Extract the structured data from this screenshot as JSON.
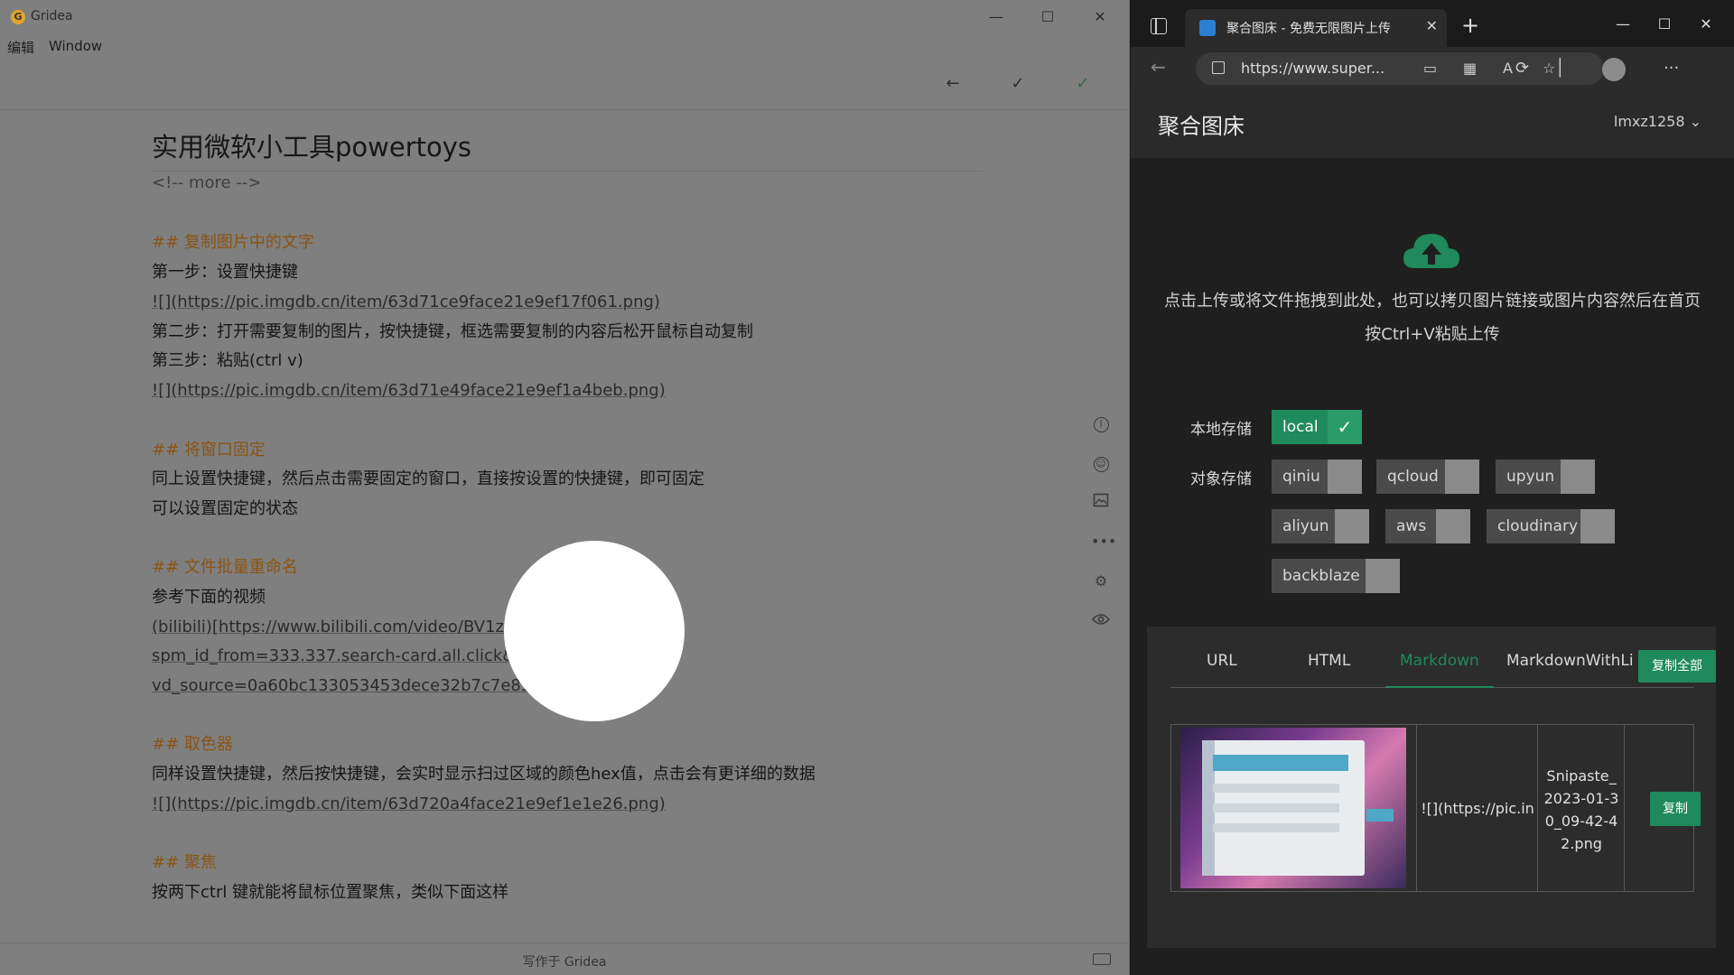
{
  "gridea": {
    "app_title": "Gridea",
    "logo_letter": "G",
    "menu": [
      "编辑",
      "Window"
    ],
    "toolbar": {
      "back": "←",
      "check1": "✓",
      "check2": "✓"
    },
    "window_controls": {
      "minimize": "—",
      "maximize": "☐",
      "close": "✕"
    },
    "doc_title": "实用微软小工具powertoys",
    "lines": [
      "<!-- more -->",
      "## 复制图片中的文字",
      "第一步：设置快捷键",
      "![](https://pic.imgdb.cn/item/63d71ce9face21e9ef17f061.png)",
      "第二步：打开需要复制的图片，按快捷键，框选需要复制的内容后松开鼠标自动复制",
      "第三步：粘贴(ctrl v)",
      "![](https://pic.imgdb.cn/item/63d71e49face21e9ef1a4beb.png)",
      "## 将窗口固定",
      "同上设置快捷键，然后点击需要固定的窗口，直接按设置的快捷键，即可固定",
      "可以设置固定的状态",
      "## 文件批量重命名",
      "参考下面的视频",
      "(bilibili)[https://www.bilibili.com/video/BV1ze4y117CZ/?",
      "spm_id_from=333.337.search-card.all.click&",
      "vd_source=0a60bc133053453dece32b7c7e830e8c]",
      "## 取色器",
      "同样设置快捷键，然后按快捷键，会实时显示扫过区域的颜色hex值，点击会有更详细的数据",
      "![](https://pic.imgdb.cn/item/63d720a4face21e9ef1e1e26.png)",
      "## 聚焦",
      "按两下ctrl 键就能将鼠标位置聚焦，类似下面这样"
    ],
    "side_icons": [
      "info-icon",
      "emoji-icon",
      "image-icon",
      "more-icon",
      "settings-icon",
      "preview-icon"
    ],
    "status_text": "写作于 Gridea"
  },
  "browser": {
    "tab_title": "聚合图床 - 免费无限图片上传",
    "url": "https://www.super...",
    "window_controls": {
      "minimize": "—",
      "maximize": "☐",
      "close": "✕"
    },
    "new_tab": "+",
    "back": "←"
  },
  "page": {
    "brand": "聚合图床",
    "user": "lmxz1258",
    "upload_desc_line1": "点击上传或将文件拖拽到此处，也可以拷贝图片链接或图片内容然后在首页",
    "upload_desc_line2": "按Ctrl+V粘贴上传",
    "local_label": "本地存储",
    "object_label": "对象存储",
    "local_store": "local",
    "object_stores": [
      "qiniu",
      "qcloud",
      "upyun",
      "aliyun",
      "aws",
      "cloudinary",
      "backblaze"
    ],
    "result_tabs": [
      "URL",
      "HTML",
      "Markdown",
      "MarkdownWithLink"
    ],
    "active_tab": "Markdown",
    "copy_all": "复制全部",
    "result_code": "![](https://pic.in",
    "result_filename_lines": [
      "Snipaste_",
      "2023-01-3",
      "0_09-42-4",
      "2.png"
    ],
    "copy_button": "复制",
    "accent_color": "#1f8a5b"
  }
}
